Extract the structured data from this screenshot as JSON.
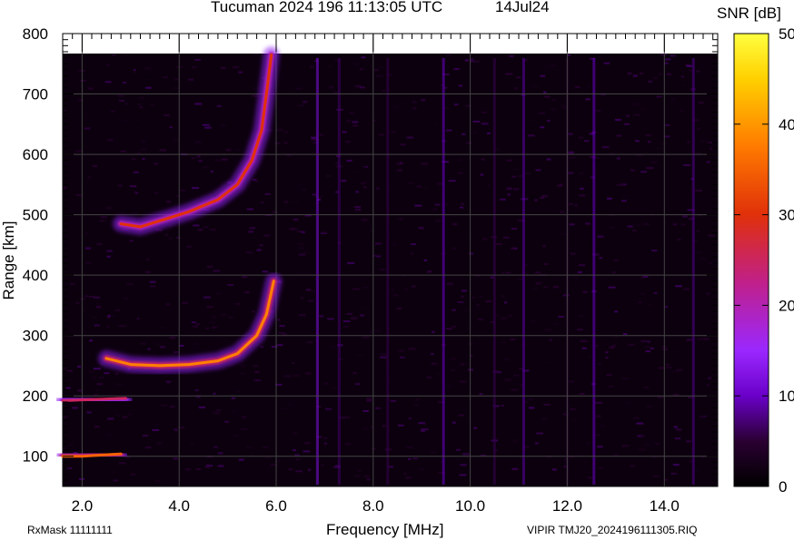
{
  "header": {
    "title": "Tucuman 2024 196 11:13:05 UTC",
    "date": "14Jul24"
  },
  "footer": {
    "rxmask": "RxMask 11111111",
    "file": "VIPIR  TMJ20_2024196111305.RIQ"
  },
  "colorbar": {
    "label": "SNR [dB]",
    "ticks": [
      "50",
      "40",
      "30",
      "20",
      "10",
      "0"
    ],
    "range": [
      0,
      50
    ],
    "colors": [
      "#000000",
      "#2a0032",
      "#6a00c8",
      "#9a28ff",
      "#c0208a",
      "#e0300a",
      "#ff7a00",
      "#ffd000",
      "#ffff40"
    ]
  },
  "chart_data": {
    "type": "heatmap",
    "title": "Tucuman 2024 196 11:13:05 UTC",
    "xlabel": "Frequency [MHz]",
    "ylabel": "Range [km]",
    "xlim": [
      1.6,
      15.1
    ],
    "ylim": [
      50,
      800
    ],
    "x_ticks": [
      "2.0",
      "4.0",
      "6.0",
      "8.0",
      "10.0",
      "12.0",
      "14.0"
    ],
    "x_tick_values": [
      2,
      4,
      6,
      8,
      10,
      12,
      14
    ],
    "y_ticks": [
      "800",
      "700",
      "600",
      "500",
      "400",
      "300",
      "200",
      "100"
    ],
    "y_tick_values": [
      800,
      700,
      600,
      500,
      400,
      300,
      200,
      100
    ],
    "grid": true,
    "traces": [
      {
        "name": "",
        "points": [
          [
            1.6,
            100
          ],
          [
            2.0,
            100
          ],
          [
            2.4,
            102
          ],
          [
            2.8,
            104
          ]
        ],
        "peak_snr": 35
      },
      {
        "name": "",
        "points": [
          [
            1.6,
            192
          ],
          [
            2.2,
            194
          ],
          [
            2.9,
            196
          ]
        ],
        "peak_snr": 25
      },
      {
        "name": "",
        "points": [
          [
            2.5,
            262
          ],
          [
            3.0,
            252
          ],
          [
            3.6,
            250
          ],
          [
            4.2,
            252
          ],
          [
            4.8,
            258
          ],
          [
            5.2,
            270
          ],
          [
            5.6,
            300
          ],
          [
            5.8,
            335
          ],
          [
            5.95,
            390
          ]
        ],
        "peak_snr": 38
      },
      {
        "name": "",
        "points": [
          [
            2.8,
            485
          ],
          [
            3.2,
            480
          ],
          [
            3.6,
            490
          ],
          [
            4.2,
            505
          ],
          [
            4.8,
            525
          ],
          [
            5.2,
            550
          ],
          [
            5.5,
            590
          ],
          [
            5.7,
            640
          ],
          [
            5.8,
            700
          ],
          [
            5.9,
            765
          ]
        ],
        "peak_snr": 30
      }
    ]
  }
}
